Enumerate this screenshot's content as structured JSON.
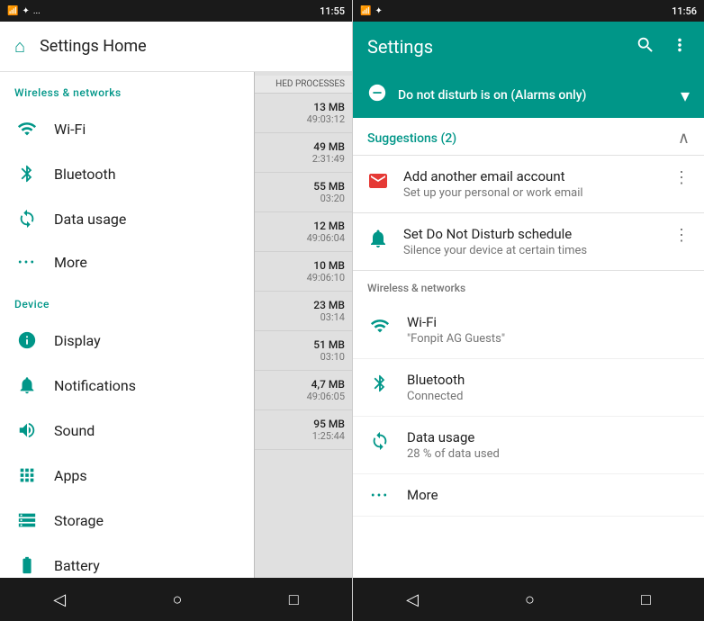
{
  "left": {
    "status_bar": {
      "time": "11:55",
      "icons_left": [
        "notification",
        "bluetooth",
        "more"
      ]
    },
    "header": {
      "title": "Settings Home"
    },
    "sections": [
      {
        "title": "Wireless & networks",
        "items": [
          {
            "id": "wifi",
            "label": "Wi-Fi",
            "icon": "wifi"
          },
          {
            "id": "bluetooth",
            "label": "Bluetooth",
            "icon": "bluetooth"
          },
          {
            "id": "data-usage",
            "label": "Data usage",
            "icon": "data"
          },
          {
            "id": "more",
            "label": "More",
            "icon": "dots"
          }
        ]
      },
      {
        "title": "Device",
        "items": [
          {
            "id": "display",
            "label": "Display",
            "icon": "display"
          },
          {
            "id": "notifications",
            "label": "Notifications",
            "icon": "bell"
          },
          {
            "id": "sound",
            "label": "Sound",
            "icon": "sound"
          },
          {
            "id": "apps",
            "label": "Apps",
            "icon": "apps"
          },
          {
            "id": "storage",
            "label": "Storage",
            "icon": "storage"
          },
          {
            "id": "battery",
            "label": "Battery",
            "icon": "battery"
          }
        ]
      }
    ],
    "cached_header": "HED PROCESSES",
    "cached_items": [
      {
        "mb": "13 MB",
        "time": "49:03:12"
      },
      {
        "mb": "49 MB",
        "time": "2:31:49"
      },
      {
        "mb": "55 MB",
        "time": "03:20"
      },
      {
        "mb": "12 MB",
        "time": "49:06:04"
      },
      {
        "mb": "10 MB",
        "time": "49:06:10"
      },
      {
        "mb": "23 MB",
        "time": "03:14"
      },
      {
        "mb": "51 MB",
        "time": "03:10"
      },
      {
        "mb": "4,7 MB",
        "time": "49:06:05"
      },
      {
        "mb": "95 MB",
        "time": "1:25:44"
      }
    ],
    "nav": {
      "back": "◁",
      "home": "○",
      "recent": "□"
    }
  },
  "right": {
    "status_bar": {
      "time": "11:56"
    },
    "header": {
      "title": "Settings",
      "search_icon": "search",
      "more_icon": "more"
    },
    "dnd_banner": {
      "text": "Do not disturb is on (Alarms only)"
    },
    "suggestions": {
      "title": "Suggestions (2)",
      "items": [
        {
          "id": "email",
          "title": "Add another email account",
          "subtitle": "Set up your personal or work email",
          "icon": "gmail"
        },
        {
          "id": "dnd-schedule",
          "title": "Set Do Not Disturb schedule",
          "subtitle": "Silence your device at certain times",
          "icon": "bell"
        }
      ]
    },
    "wireless_section": {
      "title": "Wireless & networks",
      "items": [
        {
          "id": "wifi",
          "title": "Wi-Fi",
          "subtitle": "\"Fonpit AG Guests\"",
          "icon": "wifi"
        },
        {
          "id": "bluetooth",
          "title": "Bluetooth",
          "subtitle": "Connected",
          "icon": "bluetooth"
        },
        {
          "id": "data-usage",
          "title": "Data usage",
          "subtitle": "28 % of data used",
          "icon": "data"
        },
        {
          "id": "more",
          "title": "More",
          "subtitle": "",
          "icon": "dots"
        }
      ]
    },
    "nav": {
      "back": "◁",
      "home": "○",
      "recent": "□"
    }
  }
}
